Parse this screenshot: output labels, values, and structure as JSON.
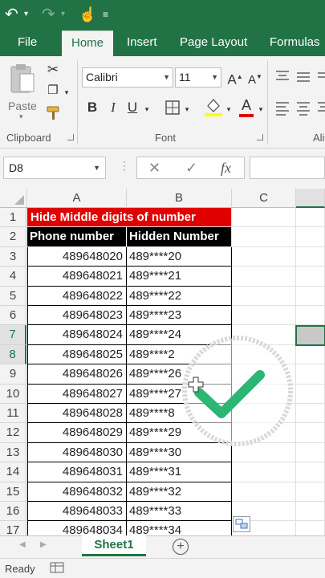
{
  "tabs": [
    "File",
    "Home",
    "Insert",
    "Page Layout",
    "Formulas"
  ],
  "ribbon": {
    "paste_label": "Paste",
    "font_name": "Calibri",
    "font_size": "11",
    "bold": "B",
    "italic": "I",
    "underline": "U",
    "font_color_letter": "A",
    "grow_font": "A",
    "shrink_font": "A",
    "clipboard_label": "Clipboard",
    "font_label": "Font",
    "alignment_label_partial": "Ali"
  },
  "formula_bar": {
    "name_box": "D8",
    "cancel": "✕",
    "enter": "✓",
    "fx": "fx"
  },
  "columns": [
    "A",
    "B",
    "C"
  ],
  "sheet": {
    "title": "Hide Middle digits of number",
    "header_a": "Phone number",
    "header_b": "Hidden Number",
    "rows": [
      {
        "row": "1"
      },
      {
        "row": "2"
      },
      {
        "row": "3",
        "a": "489648020",
        "b": "489****20"
      },
      {
        "row": "4",
        "a": "489648021",
        "b": "489****21"
      },
      {
        "row": "5",
        "a": "489648022",
        "b": "489****22"
      },
      {
        "row": "6",
        "a": "489648023",
        "b": "489****23"
      },
      {
        "row": "7",
        "a": "489648024",
        "b": "489****24"
      },
      {
        "row": "8",
        "a": "489648025",
        "b": "489****2"
      },
      {
        "row": "9",
        "a": "489648026",
        "b": "489****26"
      },
      {
        "row": "10",
        "a": "489648027",
        "b": "489****27"
      },
      {
        "row": "11",
        "a": "489648028",
        "b": "489****8"
      },
      {
        "row": "12",
        "a": "489648029",
        "b": "489****29"
      },
      {
        "row": "13",
        "a": "489648030",
        "b": "489****30"
      },
      {
        "row": "14",
        "a": "489648031",
        "b": "489****31"
      },
      {
        "row": "15",
        "a": "489648032",
        "b": "489****32"
      },
      {
        "row": "16",
        "a": "489648033",
        "b": "489****33"
      },
      {
        "row": "17",
        "a": "489648034",
        "b": "489****34"
      }
    ]
  },
  "sheet_tab": "Sheet1",
  "add_sheet": "+",
  "status": "Ready",
  "colors": {
    "accent": "#217346",
    "title_fill": "#e00000",
    "header_fill": "#000000",
    "check": "#2bb673"
  }
}
